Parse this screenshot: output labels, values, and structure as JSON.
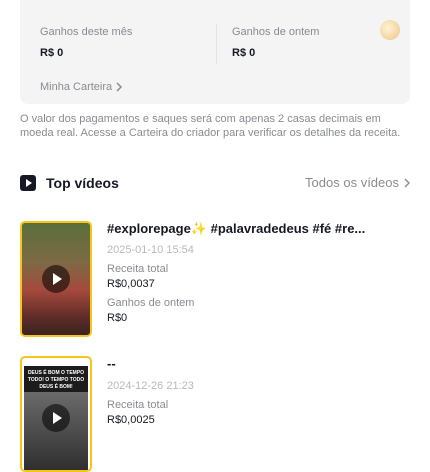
{
  "earnings": {
    "month_label": "Ganhos deste mês",
    "month_value": "R$ 0",
    "yesterday_label": "Ganhos de ontem",
    "yesterday_value": "R$ 0",
    "wallet_link": "Minha Carteira"
  },
  "notice": "O valor dos pagamentos e saques será com apenas 2 casas decimais em moeda real. Acesse a Carteira do criador para verificar os detalhes da receita.",
  "top_videos": {
    "title": "Top vídeos",
    "see_all": "Todos os vídeos"
  },
  "videos": [
    {
      "title": "#explorepage✨ #palavradedeus #fé #re...",
      "date": "2025-01-10 15:54",
      "total_label": "Receita total",
      "total_value": "R$0,0037",
      "yesterday_label": "Ganhos de ontem",
      "yesterday_value": "R$0"
    },
    {
      "title": "--",
      "date": "2024-12-26 21:23",
      "total_label": "Receita total",
      "total_value": "R$0,0025",
      "thumb_text": "DEUS É BOM O TEMPO TODO! O TEMPO TODO DEUS É BOM!"
    }
  ],
  "colors": {
    "accent_border": "#f5c518",
    "muted_text": "#8a8b91",
    "card_bg": "#f4f4f5"
  }
}
